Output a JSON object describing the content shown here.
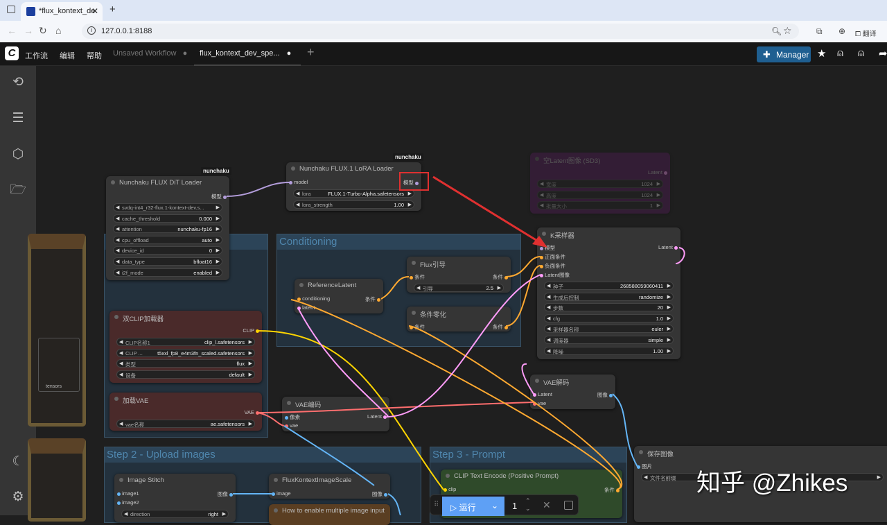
{
  "browser": {
    "tab_title": "*flux_kontext_de",
    "url": "127.0.0.1:8188",
    "translate": "翻译"
  },
  "app": {
    "menus": [
      "工作流",
      "编辑",
      "帮助"
    ],
    "tabs": [
      "Unsaved Workflow",
      "flux_kontext_dev_spe..."
    ],
    "manager": "Manager",
    "run": "运行",
    "run_count": "1"
  },
  "groups": {
    "conditioning": "Conditioning",
    "step2": "Step 2 - Upload images",
    "step3": "Step 3 - Prompt",
    "left_fragment": "tensors"
  },
  "colors": {
    "model": "#b39ddb",
    "conditioning": "#ffa931",
    "latent": "#ff9cf9",
    "clip": "#ffd500",
    "vae": "#ff6e6e",
    "image": "#64b5f6",
    "accent": "#1f5f91"
  },
  "nodes": [
    {
      "id": "dit",
      "title": "Nunchaku FLUX DiT Loader",
      "badge": "nunchaku",
      "inputs": [],
      "outputs": [
        {
          "label": "模型",
          "type": "model"
        }
      ],
      "widgets": [
        [
          "svdq-int4_r32-flux.1-kontext-dev.s...",
          ""
        ],
        [
          "cache_threshold",
          "0.000"
        ],
        [
          "attention",
          "nunchaku-fp16"
        ],
        [
          "cpu_offload",
          "auto"
        ],
        [
          "device_id",
          "0"
        ],
        [
          "data_type",
          "bfloat16"
        ],
        [
          "i2f_mode",
          "enabled"
        ]
      ]
    },
    {
      "id": "lora",
      "title": "Nunchaku FLUX.1 LoRA Loader",
      "badge": "nunchaku",
      "inputs": [
        {
          "label": "model",
          "type": "model"
        }
      ],
      "outputs": [
        {
          "label": "模型",
          "type": "model"
        }
      ],
      "widgets": [
        [
          "lora",
          "FLUX.1-Turbo-Alpha.safetensors"
        ],
        [
          "lora_strength",
          "1.00"
        ]
      ]
    },
    {
      "id": "emptylatent",
      "title": "空Latent图像 (SD3)",
      "inputs": [],
      "outputs": [
        {
          "label": "Latent",
          "type": "latent"
        }
      ],
      "widgets": [
        [
          "宽度",
          "1024"
        ],
        [
          "高度",
          "1024"
        ],
        [
          "批量大小",
          "1"
        ]
      ]
    },
    {
      "id": "ksampler",
      "title": "K采样器",
      "inputs": [
        {
          "label": "模型",
          "type": "model"
        },
        {
          "label": "正面条件",
          "type": "conditioning"
        },
        {
          "label": "负面条件",
          "type": "conditioning"
        },
        {
          "label": "Latent图像",
          "type": "latent"
        }
      ],
      "outputs": [
        {
          "label": "Latent",
          "type": "latent"
        }
      ],
      "widgets": [
        [
          "种子",
          "268588059060411"
        ],
        [
          "生成后控制",
          "randomize"
        ],
        [
          "步数",
          "20"
        ],
        [
          "cfg",
          "1.0"
        ],
        [
          "采样器名称",
          "euler"
        ],
        [
          "调度器",
          "simple"
        ],
        [
          "降噪",
          "1.00"
        ]
      ]
    },
    {
      "id": "reflatent",
      "title": "ReferenceLatent",
      "inputs": [
        {
          "label": "conditioning",
          "type": "conditioning"
        },
        {
          "label": "latent",
          "type": "latent"
        }
      ],
      "outputs": [
        {
          "label": "条件",
          "type": "conditioning"
        }
      ],
      "widgets": []
    },
    {
      "id": "fluxguide",
      "title": "Flux引导",
      "inputs": [
        {
          "label": "条件",
          "type": "conditioning"
        }
      ],
      "outputs": [
        {
          "label": "条件",
          "type": "conditioning"
        }
      ],
      "widgets": [
        [
          "引导",
          "2.5"
        ]
      ]
    },
    {
      "id": "condzero",
      "title": "条件零化",
      "inputs": [
        {
          "label": "条件",
          "type": "conditioning"
        }
      ],
      "outputs": [
        {
          "label": "条件",
          "type": "conditioning"
        }
      ],
      "widgets": []
    },
    {
      "id": "dualclip",
      "title": "双CLIP加载器",
      "inputs": [],
      "outputs": [
        {
          "label": "CLIP",
          "type": "clip"
        }
      ],
      "widgets": [
        [
          "CLIP名称1",
          "clip_l.safetensors"
        ],
        [
          "CLIP ...",
          "t5xxl_fp8_e4m3fn_scaled.safetensors"
        ],
        [
          "类型",
          "flux"
        ],
        [
          "设备",
          "default"
        ]
      ]
    },
    {
      "id": "vaeloader",
      "title": "加载VAE",
      "inputs": [],
      "outputs": [
        {
          "label": "VAE",
          "type": "vae"
        }
      ],
      "widgets": [
        [
          "vae名称",
          "ae.safetensors"
        ]
      ]
    },
    {
      "id": "vaeencode",
      "title": "VAE编码",
      "inputs": [
        {
          "label": "像素",
          "type": "image"
        },
        {
          "label": "vae",
          "type": "vae"
        }
      ],
      "outputs": [
        {
          "label": "Latent",
          "type": "latent"
        }
      ],
      "widgets": []
    },
    {
      "id": "vaedecode",
      "title": "VAE解码",
      "inputs": [
        {
          "label": "Latent",
          "type": "latent"
        },
        {
          "label": "vae",
          "type": "vae"
        }
      ],
      "outputs": [
        {
          "label": "图像",
          "type": "image"
        }
      ],
      "widgets": []
    },
    {
      "id": "save",
      "title": "保存图像",
      "inputs": [
        {
          "label": "图片",
          "type": "image"
        }
      ],
      "outputs": [],
      "widgets": [
        [
          "文件名前缀",
          ""
        ]
      ]
    },
    {
      "id": "stitch",
      "title": "Image Stitch",
      "inputs": [
        {
          "label": "image1",
          "type": "image"
        },
        {
          "label": "image2",
          "type": "image"
        }
      ],
      "outputs": [
        {
          "label": "图像",
          "type": "image"
        }
      ],
      "widgets": [
        [
          "direction",
          "right"
        ]
      ]
    },
    {
      "id": "scale",
      "title": "FluxKontextImageScale",
      "inputs": [
        {
          "label": "image",
          "type": "image"
        }
      ],
      "outputs": [
        {
          "label": "图像",
          "type": "image"
        }
      ],
      "widgets": []
    },
    {
      "id": "note",
      "title": "How to enable multiple image input",
      "inputs": [],
      "outputs": [],
      "widgets": []
    },
    {
      "id": "cliptext",
      "title": "CLIP Text Encode (Positive Prompt)",
      "inputs": [
        {
          "label": "clip",
          "type": "clip"
        }
      ],
      "outputs": [
        {
          "label": "条件",
          "type": "conditioning"
        }
      ],
      "widgets": []
    }
  ],
  "watermark": "知乎 @Zhikes"
}
